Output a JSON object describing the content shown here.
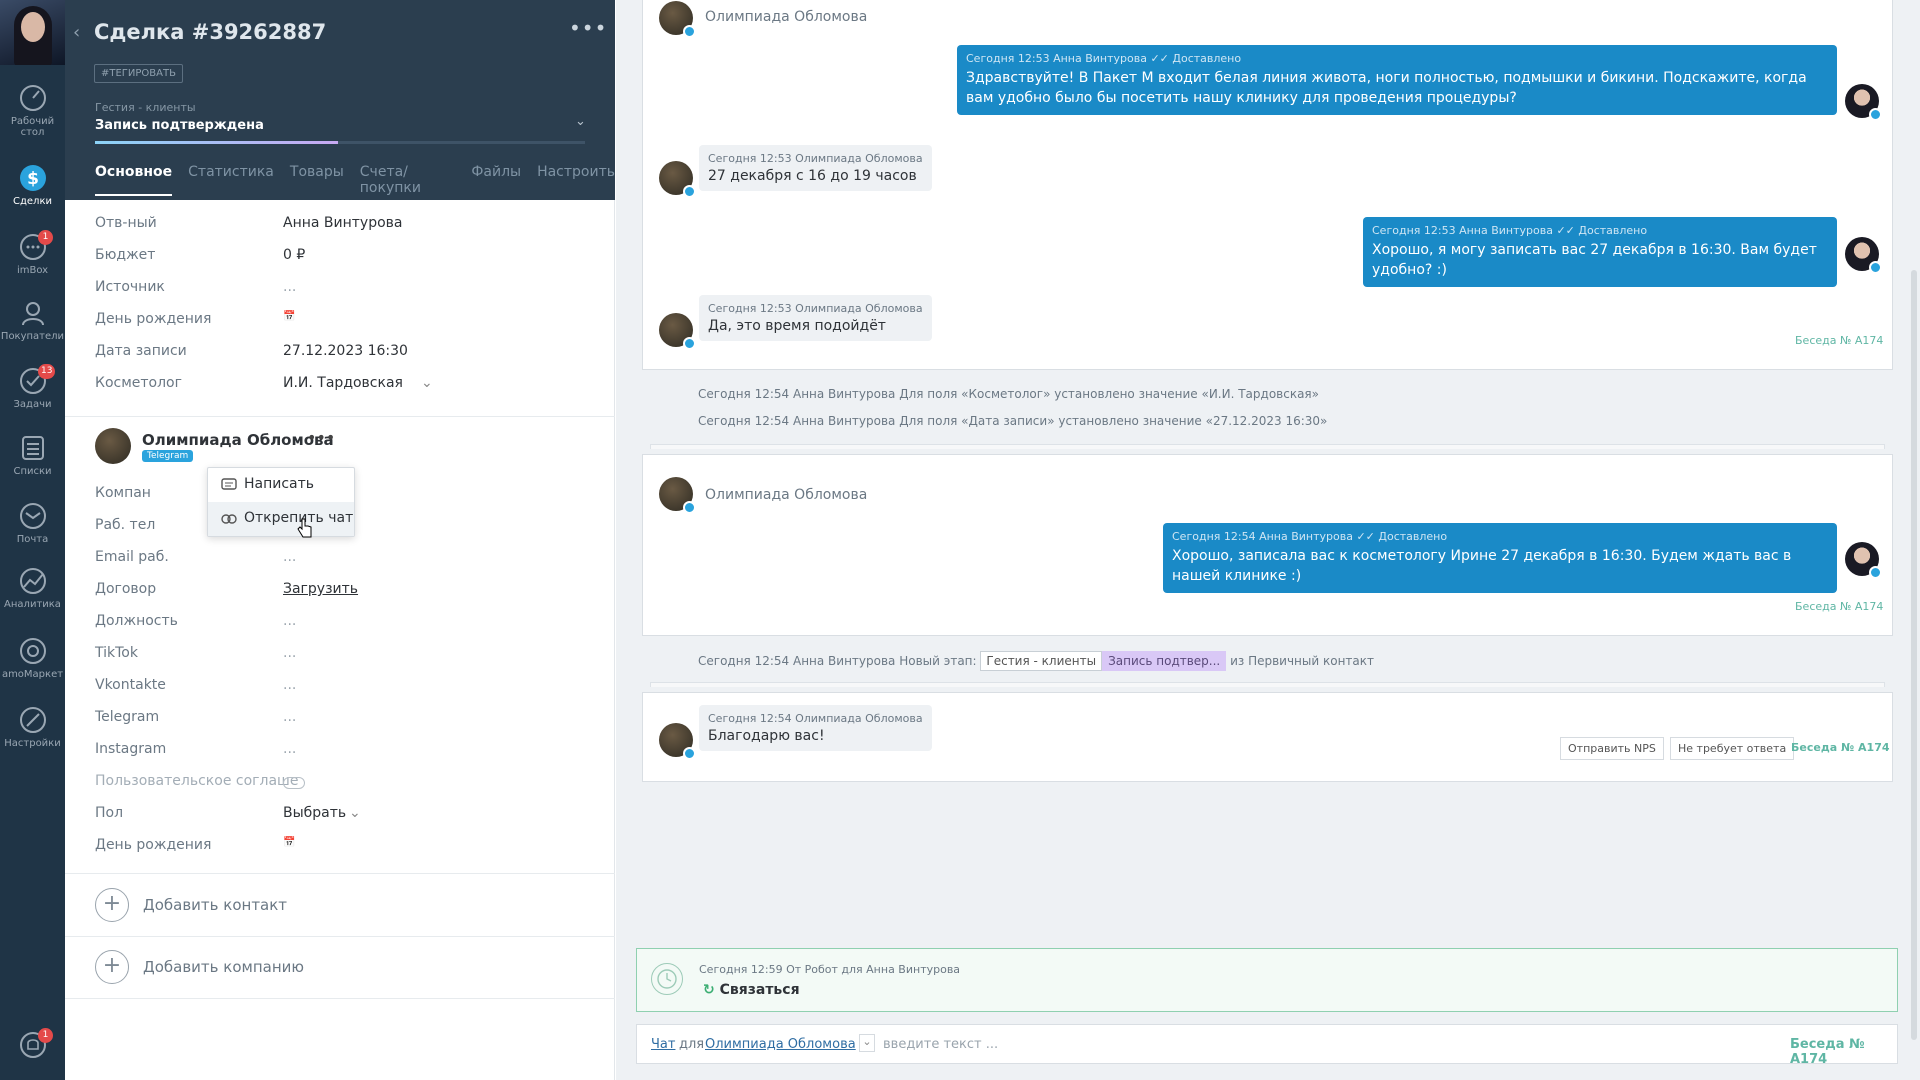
{
  "nav": {
    "items": [
      {
        "label": "Рабочий стол",
        "icon": "dashboard-icon"
      },
      {
        "label": "Сделки",
        "icon": "deals-icon",
        "active": true
      },
      {
        "label": "imBox",
        "icon": "chat-icon",
        "badge": "1"
      },
      {
        "label": "Покупатели",
        "icon": "customers-icon"
      },
      {
        "label": "Задачи",
        "icon": "tasks-icon",
        "badge": "13"
      },
      {
        "label": "Списки",
        "icon": "lists-icon"
      },
      {
        "label": "Почта",
        "icon": "mail-icon"
      },
      {
        "label": "Аналитика",
        "icon": "analytics-icon"
      },
      {
        "label": "amoМаркет",
        "icon": "market-icon"
      },
      {
        "label": "Настройки",
        "icon": "settings-icon"
      }
    ],
    "bell_badge": "1"
  },
  "deal": {
    "title": "Сделка #39262887",
    "tag_button": "#ТЕГИРОВАТЬ",
    "pipeline": "Гестия - клиенты",
    "stage": "Запись подтверждена",
    "stage_progress": 0.495,
    "tabs": [
      "Основное",
      "Статистика",
      "Товары",
      "Счета/покупки",
      "Файлы",
      "Настроить"
    ],
    "fields": [
      {
        "label": "Отв-ный",
        "value": "Анна Винтурова"
      },
      {
        "label": "Бюджет",
        "value": "0 ₽"
      },
      {
        "label": "Источник",
        "value": "..."
      },
      {
        "label": "День рождения",
        "value": "📅"
      },
      {
        "label": "Дата записи",
        "value": "27.12.2023 16:30"
      },
      {
        "label": "Косметолог",
        "value": "И.И. Тардовская"
      }
    ]
  },
  "contact": {
    "name": "Олимпиада Обломова",
    "channel": "Telegram",
    "popup": [
      "Написать",
      "Открепить чат"
    ],
    "fields": [
      {
        "label": "Компан",
        "value": ""
      },
      {
        "label": "Раб. тел",
        "value": ""
      },
      {
        "label": "Email раб.",
        "value": "..."
      },
      {
        "label": "Договор",
        "value": "Загрузить"
      },
      {
        "label": "Должность",
        "value": "..."
      },
      {
        "label": "TikTok",
        "value": "..."
      },
      {
        "label": "Vkontakte",
        "value": "..."
      },
      {
        "label": "Telegram",
        "value": "..."
      },
      {
        "label": "Instagram",
        "value": "..."
      },
      {
        "label": "Пользовательское соглаше",
        "value": ""
      },
      {
        "label": "Пол",
        "value": "Выбрать"
      },
      {
        "label": "День рождения",
        "value": "📅"
      }
    ],
    "add_contact": "Добавить контакт",
    "add_company": "Добавить компанию"
  },
  "feed": {
    "contact_name": "Олимпиада Обломова",
    "talk_label": "Беседа № А174",
    "messages": [
      {
        "meta": "Сегодня 12:53 Анна Винтурова ✓✓ Доставлено",
        "text": "Здравствуйте! В Пакет М входит белая линия живота, ноги полностью, подмышки и бикини. Подскажите, когда вам удобно было бы посетить нашу клинику для проведения процедуры?"
      },
      {
        "meta": "Сегодня 12:53 Олимпиада Обломова",
        "text": "27 декабря с 16 до 19 часов"
      },
      {
        "meta": "Сегодня 12:53 Анна Винтурова ✓✓ Доставлено",
        "text": "Хорошо, я могу записать вас 27 декабря в 16:30. Вам будет удобно? :)"
      },
      {
        "meta": "Сегодня 12:53 Олимпиада Обломова",
        "text": "Да, это время подойдёт"
      },
      {
        "meta": "Сегодня 12:54 Анна Винтурова ✓✓ Доставлено",
        "text": "Хорошо, записала вас к косметологу Ирине 27 декабря в 16:30. Будем ждать вас в нашей клинике :)"
      },
      {
        "meta": "Сегодня 12:54 Олимпиада Обломова",
        "text": "Благодарю вас!"
      }
    ],
    "system": [
      "Сегодня 12:54 Анна Винтурова Для поля «Косметолог» установлено значение «И.И. Тардовская»",
      "Сегодня 12:54 Анна Винтурова Для поля «Дата записи» установлено значение «27.12.2023 16:30»"
    ],
    "stage_change": {
      "prefix": "Сегодня 12:54 Анна Винтурова Новый этап:",
      "pipeline": "Гестия - клиенты",
      "stage": "Запись подтвер...",
      "suffix": "из Первичный контакт"
    },
    "buttons": {
      "nps": "Отправить NPS",
      "no_reply": "Не требует ответа"
    },
    "task": {
      "meta": "Сегодня 12:59 От Робот для Анна Винтурова",
      "text": "Связаться"
    },
    "chat_bar": {
      "chat": "Чат",
      "for": "для",
      "contact": "Олимпиада Обломова",
      "placeholder": "введите текст ..."
    }
  }
}
